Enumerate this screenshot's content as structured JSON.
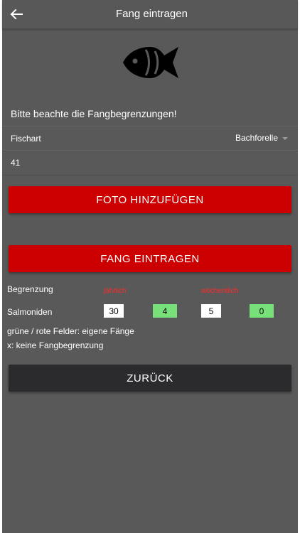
{
  "header": {
    "title": "Fang eintragen"
  },
  "notice": "Bitte beachte die Fangbegrenzungen!",
  "form": {
    "species_label": "Fischart",
    "species_value": "Bachforelle",
    "size_value": "41"
  },
  "buttons": {
    "photo": "FOTO HINZUFÜGEN",
    "catch": "FANG EINTRAGEN",
    "back": "ZURÜCK"
  },
  "limits": {
    "header_label": "Begrenzung",
    "yearly_label": "jährlich",
    "weekly_label": "wöchentlich",
    "rows": [
      {
        "name": "Salmoniden",
        "yearly_limit": "30",
        "yearly_caught": "4",
        "weekly_limit": "5",
        "weekly_caught": "0"
      }
    ]
  },
  "legend": {
    "line1": "grüne / rote Felder: eigene Fänge",
    "line2": "x: keine Fangbegrenzung"
  },
  "colors": {
    "accent_red": "#cc0000",
    "green": "#77e07a",
    "background": "#595959",
    "dark_button": "#2b2b2e"
  }
}
